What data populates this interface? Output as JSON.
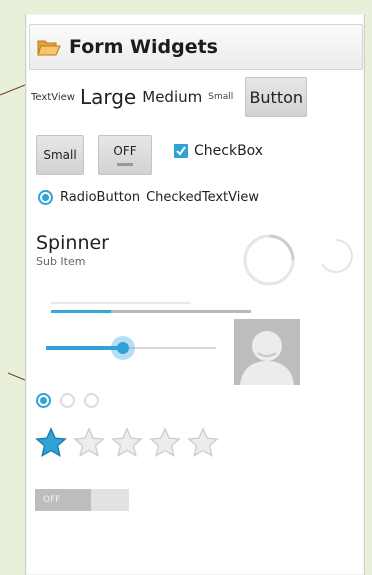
{
  "app": {
    "title": "Form Widgets",
    "icon": "folder-open-icon"
  },
  "row1": {
    "text_tiny": "TextView",
    "text_large": "Large",
    "text_medium": "Medium",
    "text_small": "Small",
    "button": "Button"
  },
  "row2": {
    "small_button": "Small",
    "toggle_label": "OFF",
    "checkbox_label": "CheckBox",
    "checkbox_checked": true
  },
  "row3": {
    "radio_label": "RadioButton",
    "radio_checked": true,
    "checked_text_view": "CheckedTextView"
  },
  "spinner": {
    "main": "Spinner",
    "sub": "Sub Item"
  },
  "progress": {
    "horizontal_percent": 30
  },
  "seekbar": {
    "percent": 45
  },
  "image": {
    "icon": "person-placeholder-icon"
  },
  "radios": [
    {
      "checked": true
    },
    {
      "checked": false
    },
    {
      "checked": false
    }
  ],
  "rating": {
    "value": 1,
    "max": 5
  },
  "switch": {
    "label": "OFF"
  },
  "colors": {
    "accent": "#2fa3d8",
    "background": "#e9f0d9"
  }
}
